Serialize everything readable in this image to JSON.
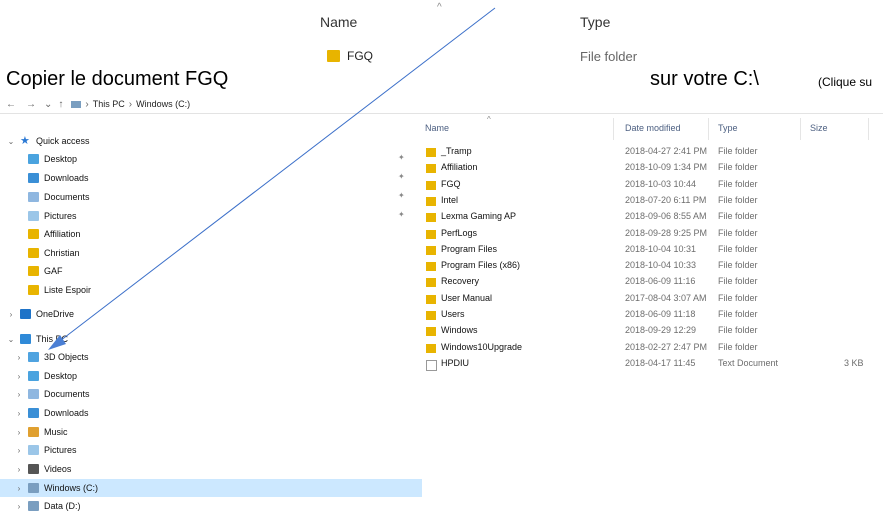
{
  "snippet": {
    "name_header": "Name",
    "type_header": "Type",
    "item_name": "FGQ",
    "item_type": "File folder"
  },
  "instruction": {
    "part1": "Copier le document FGQ",
    "part2": "sur votre C:\\",
    "part3": "(Clique su"
  },
  "addressbar": {
    "back": "←",
    "forward": "→",
    "recent": "⌄",
    "up": "↑",
    "crumbs": [
      "This PC",
      "Windows (C:)"
    ],
    "sep": "›"
  },
  "tree": [
    {
      "label": "Quick access",
      "icon": "star-icon",
      "color": "#2b79d4",
      "level": 0,
      "chev": "⌄"
    },
    {
      "label": "Desktop",
      "icon": "desktop-folder-icon",
      "color": "#4aa3df",
      "level": 1,
      "pin": true
    },
    {
      "label": "Downloads",
      "icon": "downloads-folder-icon",
      "color": "#3a8fd6",
      "level": 1,
      "pin": true
    },
    {
      "label": "Documents",
      "icon": "documents-folder-icon",
      "color": "#8fb7e0",
      "level": 1,
      "pin": true
    },
    {
      "label": "Pictures",
      "icon": "pictures-folder-icon",
      "color": "#9bc6e8",
      "level": 1,
      "pin": true
    },
    {
      "label": "Affiliation",
      "icon": "folder-icon",
      "color": "#E8B400",
      "level": 1
    },
    {
      "label": "Christian",
      "icon": "folder-icon",
      "color": "#E8B400",
      "level": 1
    },
    {
      "label": "GAF",
      "icon": "folder-icon",
      "color": "#E8B400",
      "level": 1
    },
    {
      "label": "Liste Espoir",
      "icon": "folder-icon",
      "color": "#E8B400",
      "level": 1
    },
    {
      "label": "OneDrive",
      "icon": "cloud-icon",
      "color": "#1e73c8",
      "level": 0,
      "chev": "›",
      "gap": true
    },
    {
      "label": "This PC",
      "icon": "computer-icon",
      "color": "#2f8ad8",
      "level": 0,
      "chev": "⌄",
      "gap": true
    },
    {
      "label": "3D Objects",
      "icon": "3d-objects-icon",
      "color": "#4fa3e0",
      "level": 1,
      "chev": "›"
    },
    {
      "label": "Desktop",
      "icon": "desktop-folder-icon",
      "color": "#4aa3df",
      "level": 1,
      "chev": "›"
    },
    {
      "label": "Documents",
      "icon": "documents-folder-icon",
      "color": "#8fb7e0",
      "level": 1,
      "chev": "›"
    },
    {
      "label": "Downloads",
      "icon": "downloads-folder-icon",
      "color": "#3a8fd6",
      "level": 1,
      "chev": "›"
    },
    {
      "label": "Music",
      "icon": "music-folder-icon",
      "color": "#e0a030",
      "level": 1,
      "chev": "›"
    },
    {
      "label": "Pictures",
      "icon": "pictures-folder-icon",
      "color": "#9bc6e8",
      "level": 1,
      "chev": "›"
    },
    {
      "label": "Videos",
      "icon": "videos-folder-icon",
      "color": "#555",
      "level": 1,
      "chev": "›"
    },
    {
      "label": "Windows (C:)",
      "icon": "drive-icon",
      "color": "#7a9ec0",
      "level": 1,
      "chev": "›",
      "selected": true
    },
    {
      "label": "Data (D:)",
      "icon": "drive-icon",
      "color": "#7a9ec0",
      "level": 1,
      "chev": "›"
    }
  ],
  "list_headers": {
    "name": "Name",
    "date": "Date modified",
    "type": "Type",
    "size": "Size"
  },
  "files": [
    {
      "name": "_Tramp",
      "date": "2018-04-27 2:41 PM",
      "type": "File folder",
      "size": ""
    },
    {
      "name": "Affiliation",
      "date": "2018-10-09 1:34 PM",
      "type": "File folder",
      "size": ""
    },
    {
      "name": "FGQ",
      "date": "2018-10-03 10:44",
      "type": "File folder",
      "size": ""
    },
    {
      "name": "Intel",
      "date": "2018-07-20 6:11 PM",
      "type": "File folder",
      "size": ""
    },
    {
      "name": "Lexma Gaming AP",
      "date": "2018-09-06 8:55 AM",
      "type": "File folder",
      "size": ""
    },
    {
      "name": "PerfLogs",
      "date": "2018-09-28 9:25 PM",
      "type": "File folder",
      "size": ""
    },
    {
      "name": "Program Files",
      "date": "2018-10-04 10:31",
      "type": "File folder",
      "size": ""
    },
    {
      "name": "Program Files (x86)",
      "date": "2018-10-04 10:33",
      "type": "File folder",
      "size": ""
    },
    {
      "name": "Recovery",
      "date": "2018-06-09 11:16",
      "type": "File folder",
      "size": ""
    },
    {
      "name": "User Manual",
      "date": "2017-08-04 3:07 AM",
      "type": "File folder",
      "size": ""
    },
    {
      "name": "Users",
      "date": "2018-06-09 11:18",
      "type": "File folder",
      "size": ""
    },
    {
      "name": "Windows",
      "date": "2018-09-29 12:29",
      "type": "File folder",
      "size": ""
    },
    {
      "name": "Windows10Upgrade",
      "date": "2018-02-27 2:47 PM",
      "type": "File folder",
      "size": ""
    },
    {
      "name": "HPDIU",
      "date": "2018-04-17 11:45",
      "type": "Text Document",
      "size": "3 KB",
      "file": true
    }
  ],
  "colors": {
    "folder": "#E8B400",
    "selection": "#cce8ff",
    "arrow": "#3b6fc9"
  }
}
